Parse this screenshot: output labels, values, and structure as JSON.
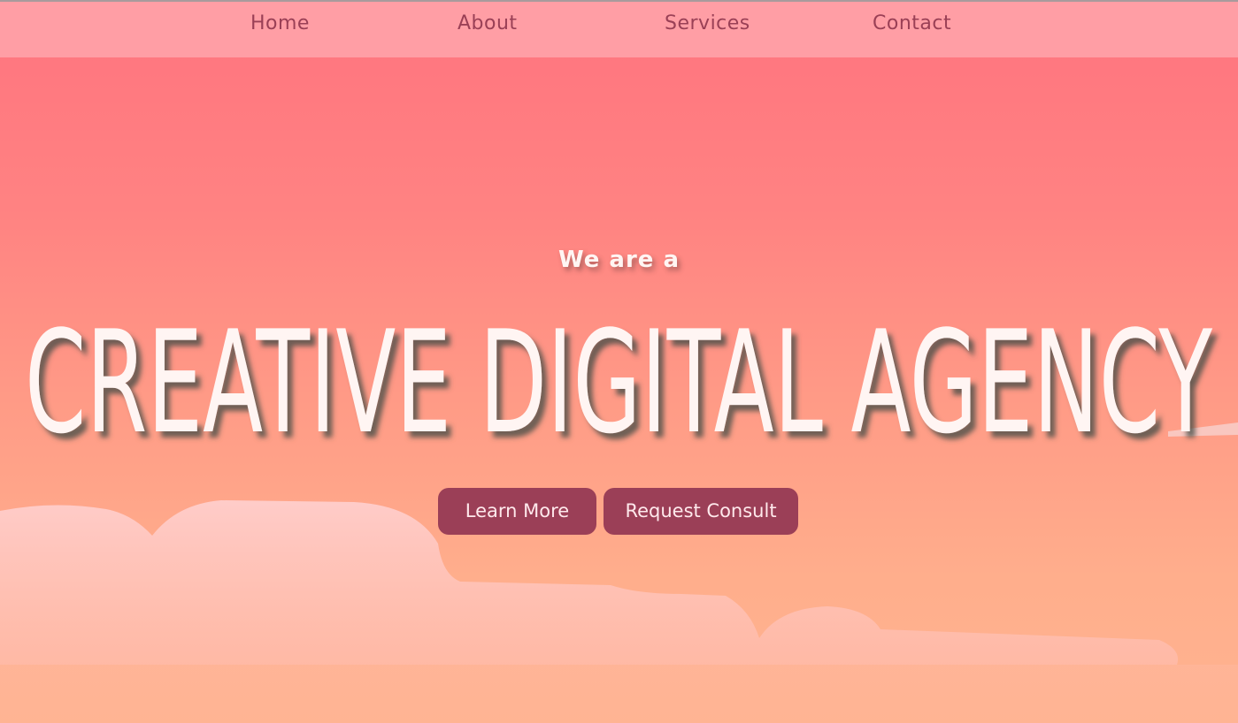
{
  "nav": {
    "items": [
      {
        "label": "Home"
      },
      {
        "label": "About"
      },
      {
        "label": "Services"
      },
      {
        "label": "Contact"
      }
    ]
  },
  "hero": {
    "subtitle": "We are a",
    "title": "CREATIVE DIGITAL AGENCY",
    "buttons": {
      "learn_more": "Learn More",
      "request_consult": "Request Consult"
    }
  },
  "colors": {
    "sky_top": "#ff737f",
    "sky_bottom": "#ffb390",
    "navbar": "#ff9ea5",
    "nav_text": "#9a4056",
    "button": "#9b3f57",
    "title_text": "#fff5f3"
  }
}
